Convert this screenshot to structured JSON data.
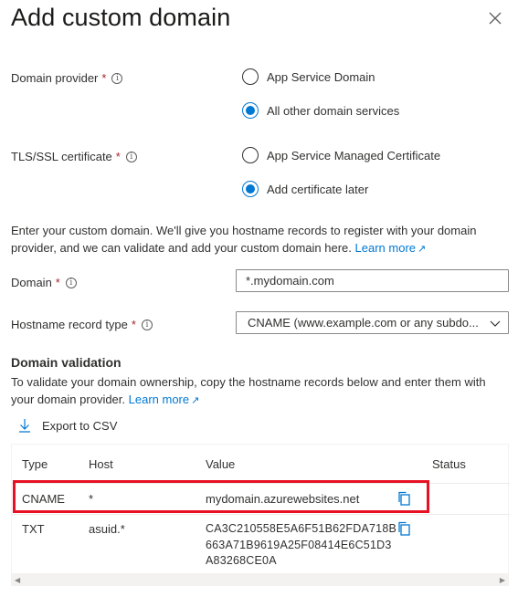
{
  "header": {
    "title": "Add custom domain"
  },
  "domain_provider": {
    "label": "Domain provider",
    "required_mark": "*",
    "options": [
      "App Service Domain",
      "All other domain services"
    ],
    "selected": "All other domain services"
  },
  "tls_ssl": {
    "label": "TLS/SSL certificate",
    "required_mark": "*",
    "options": [
      "App Service Managed Certificate",
      "Add certificate later"
    ],
    "selected": "Add certificate later"
  },
  "intro": {
    "text": "Enter your custom domain. We'll give you hostname records to register with your domain provider, and we can validate and add your custom domain here.",
    "link": "Learn more"
  },
  "domain_field": {
    "label": "Domain",
    "required_mark": "*",
    "value": "*.mydomain.com"
  },
  "hostname_record_type": {
    "label": "Hostname record type",
    "required_mark": "*",
    "value": "CNAME (www.example.com or any subdo..."
  },
  "domain_validation": {
    "title": "Domain validation",
    "text": "To validate your domain ownership, copy the hostname records below and enter them with your domain provider.",
    "link": "Learn more"
  },
  "export_label": "Export to CSV",
  "table": {
    "headers": [
      "Type",
      "Host",
      "Value",
      "Status"
    ],
    "rows": [
      {
        "type": "CNAME",
        "host": "*",
        "value": "mydomain.azurewebsites.net",
        "status": ""
      },
      {
        "type": "TXT",
        "host": "asuid.*",
        "value_lines": [
          "CA3C210558E5A6F51B62FDA718B",
          "663A71B9619A25F08414E6C51D3",
          "A83268CE0A"
        ],
        "status": ""
      }
    ]
  },
  "colors": {
    "accent": "#0078d4",
    "highlight": "#e81123",
    "required": "#a4262c"
  },
  "icons": [
    "close-icon",
    "info-icon",
    "external-link-icon",
    "download-icon",
    "copy-icon",
    "chevron-down-icon"
  ]
}
